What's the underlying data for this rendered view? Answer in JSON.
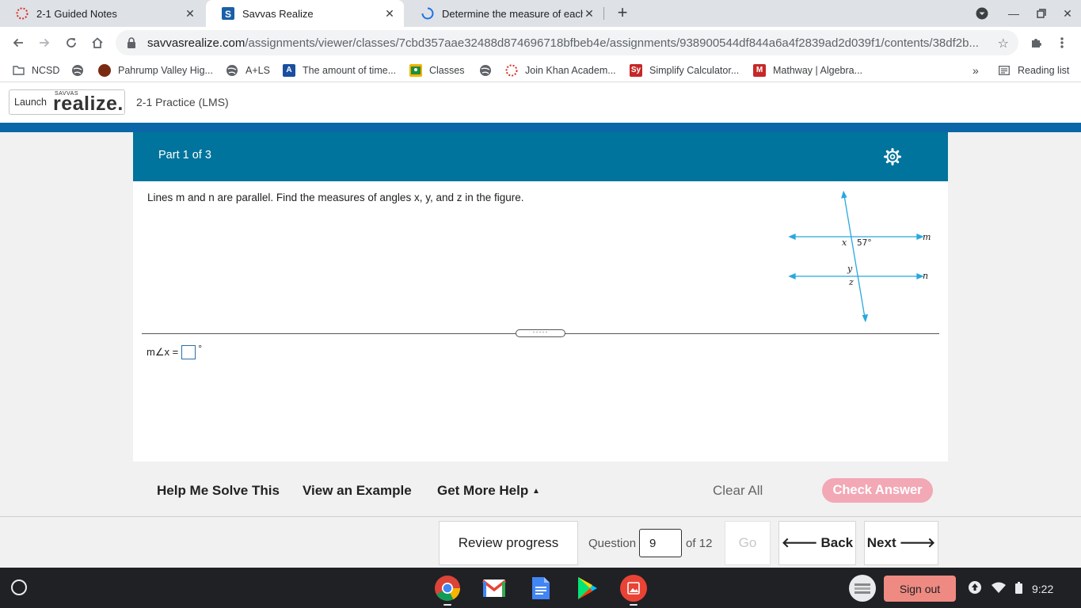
{
  "browser": {
    "tabs": [
      {
        "title": "2-1 Guided Notes",
        "active": false
      },
      {
        "title": "Savvas Realize",
        "active": true
      },
      {
        "title": "Determine the measure of each c",
        "active": false
      }
    ],
    "url_host": "savvasrealize.com",
    "url_path": "/assignments/viewer/classes/7cbd357aae32488d874696718bfbeb4e/assignments/938900544df844a6a4f2839ad2d039f1/contents/38df2b...",
    "bookmarks": [
      {
        "label": "NCSD",
        "icon": "folder-icon"
      },
      {
        "label": "",
        "icon": "globe-icon"
      },
      {
        "label": "Pahrump Valley Hig...",
        "icon": "school-icon"
      },
      {
        "label": "A+LS",
        "icon": "globe-icon"
      },
      {
        "label": "The amount of time...",
        "icon": "a-icon"
      },
      {
        "label": "Classes",
        "icon": "classroom-icon"
      },
      {
        "label": "",
        "icon": "globe-icon"
      },
      {
        "label": "Join Khan Academ...",
        "icon": "khan-icon"
      },
      {
        "label": "Simplify Calculator...",
        "icon": "sy-icon"
      },
      {
        "label": "Mathway | Algebra...",
        "icon": "mathway-icon"
      }
    ],
    "overflow": "»",
    "reading_list": "Reading list"
  },
  "app": {
    "launch_label": "Launch",
    "logo_top": "SAVVAS",
    "logo_main": "realize.",
    "title": "2-1 Practice (LMS)"
  },
  "question": {
    "part": "Part 1 of 3",
    "prompt": "Lines m and n are parallel. Find the measures of angles x, y, and z in the figure.",
    "figure": {
      "angle": "57°",
      "labels": [
        "x",
        "y",
        "z",
        "m",
        "n"
      ]
    },
    "answer_prefix": "m∠x =",
    "answer_suffix": "°"
  },
  "help": {
    "help_me_solve": "Help Me Solve This",
    "view_example": "View an Example",
    "get_more_help": "Get More Help",
    "clear_all": "Clear All",
    "check_answer": "Check Answer"
  },
  "footer": {
    "review_progress": "Review progress",
    "question_label": "Question",
    "question_number": "9",
    "of_total": "of 12",
    "go": "Go",
    "back": "Back",
    "next": "Next"
  },
  "shelf": {
    "sign_out": "Sign out",
    "time": "9:22"
  },
  "colors": {
    "header_teal": "#00749c",
    "blue_bar": "#0b66a8",
    "check_answer_disabled": "#f2a8b5",
    "sign_out": "#ee8a82"
  }
}
